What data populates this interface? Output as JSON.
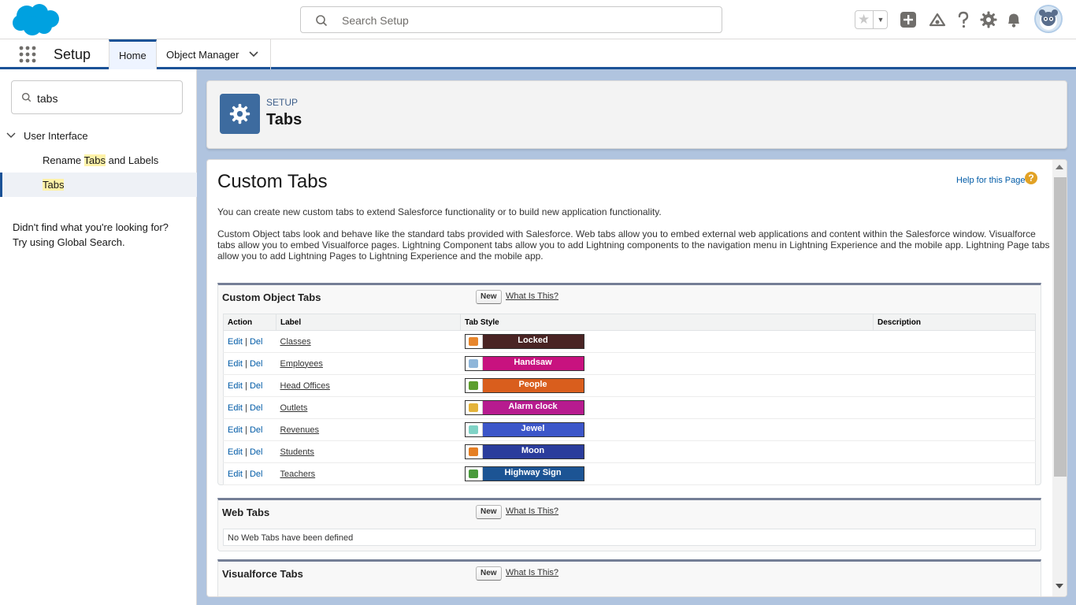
{
  "header": {
    "search_placeholder": "Search Setup",
    "icons": [
      "favorites-star-icon",
      "add-icon",
      "trailhead-icon",
      "help-icon",
      "gear-icon",
      "bell-icon",
      "avatar"
    ]
  },
  "context": {
    "app_name": "Setup",
    "tabs": [
      {
        "label": "Home",
        "active": true
      },
      {
        "label": "Object Manager",
        "active": false
      }
    ]
  },
  "sidebar": {
    "quickfind_value": "tabs",
    "group_label": "User Interface",
    "items": [
      {
        "pre": "Rename ",
        "hl": "Tabs",
        "post": " and Labels",
        "active": false
      },
      {
        "pre": "",
        "hl": "Tabs",
        "post": "",
        "active": true
      }
    ],
    "hint_line1": "Didn't find what you're looking for?",
    "hint_line2": "Try using Global Search."
  },
  "page_header": {
    "eyebrow": "SETUP",
    "title": "Tabs"
  },
  "content": {
    "title": "Custom Tabs",
    "help_link": "Help for this Page",
    "intro1": "You can create new custom tabs to extend Salesforce functionality or to build new application functionality.",
    "intro2": "Custom Object tabs look and behave like the standard tabs provided with Salesforce. Web tabs allow you to embed external web applications and content within the Salesforce window. Visualforce tabs allow you to embed Visualforce pages. Lightning Component tabs allow you to add Lightning components to the navigation menu in Lightning Experience and the mobile app. Lightning Page tabs allow you to add Lightning Pages to Lightning Experience and the mobile app.",
    "sections": {
      "custom_object": {
        "title": "Custom Object Tabs",
        "new_label": "New",
        "what_label": "What Is This?",
        "columns": [
          "Action",
          "Label",
          "Tab Style",
          "Description"
        ],
        "edit_label": "Edit",
        "del_label": "Del",
        "rows": [
          {
            "label": "Classes",
            "style": "Locked",
            "color": "#4a2424",
            "icon_color": "#e8862c"
          },
          {
            "label": "Employees",
            "style": "Handsaw",
            "color": "#c8127f",
            "icon_color": "#8fb6d9"
          },
          {
            "label": "Head Offices",
            "style": "People",
            "color": "#d95e1d",
            "icon_color": "#5c9e2e"
          },
          {
            "label": "Outlets",
            "style": "Alarm clock",
            "color": "#b71b8f",
            "icon_color": "#e4b33a"
          },
          {
            "label": "Revenues",
            "style": "Jewel",
            "color": "#3c56c9",
            "icon_color": "#7fd3c6"
          },
          {
            "label": "Students",
            "style": "Moon",
            "color": "#2a3c9c",
            "icon_color": "#e57e22"
          },
          {
            "label": "Teachers",
            "style": "Highway Sign",
            "color": "#1c5494",
            "icon_color": "#4a9a3c"
          }
        ]
      },
      "web": {
        "title": "Web Tabs",
        "new_label": "New",
        "what_label": "What Is This?",
        "empty": "No Web Tabs have been defined"
      },
      "visualforce": {
        "title": "Visualforce Tabs",
        "new_label": "New",
        "what_label": "What Is This?"
      }
    }
  }
}
